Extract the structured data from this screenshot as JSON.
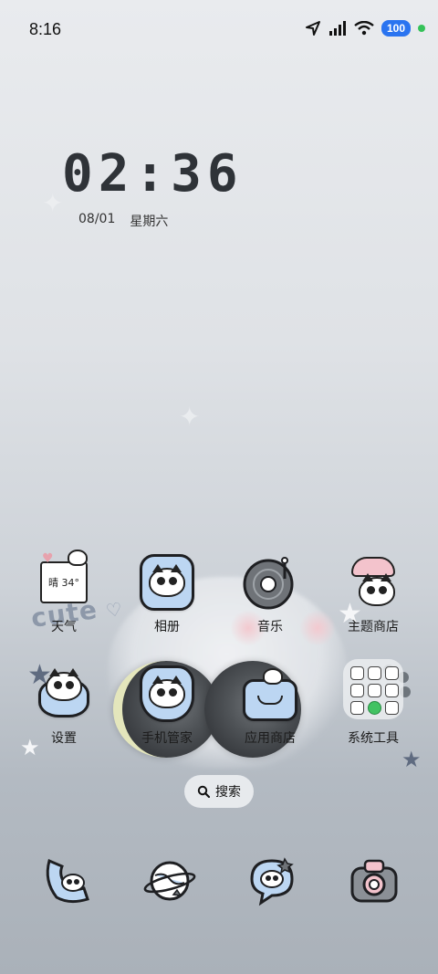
{
  "status_bar": {
    "time": "8:16",
    "battery": "100",
    "icons": [
      "location-arrow-icon",
      "signal-icon",
      "wifi-icon",
      "battery-icon",
      "green-dot-icon"
    ]
  },
  "clock_widget": {
    "time": "02:36",
    "date": "08/01",
    "weekday": "星期六"
  },
  "wallpaper": {
    "text": "cute"
  },
  "apps_row1": [
    {
      "label": "天气",
      "icon": "weather-cat-icon",
      "weather_text": "晴 34°"
    },
    {
      "label": "相册",
      "icon": "photo-cat-icon"
    },
    {
      "label": "音乐",
      "icon": "music-record-icon"
    },
    {
      "label": "主题商店",
      "icon": "theme-cat-icon"
    }
  ],
  "apps_row2": [
    {
      "label": "设置",
      "icon": "settings-cat-icon"
    },
    {
      "label": "手机管家",
      "icon": "phone-manager-icon"
    },
    {
      "label": "应用商店",
      "icon": "app-store-icon"
    },
    {
      "label": "系统工具",
      "icon": "folder-icon"
    }
  ],
  "search": {
    "label": "搜索"
  },
  "dock": [
    {
      "icon": "phone-cat-icon"
    },
    {
      "icon": "browser-planet-icon"
    },
    {
      "icon": "message-cat-icon"
    },
    {
      "icon": "camera-icon"
    }
  ],
  "colors": {
    "accent_blue": "#bcd6f2",
    "battery_blue": "#2a74f0",
    "status_green": "#35c259"
  }
}
